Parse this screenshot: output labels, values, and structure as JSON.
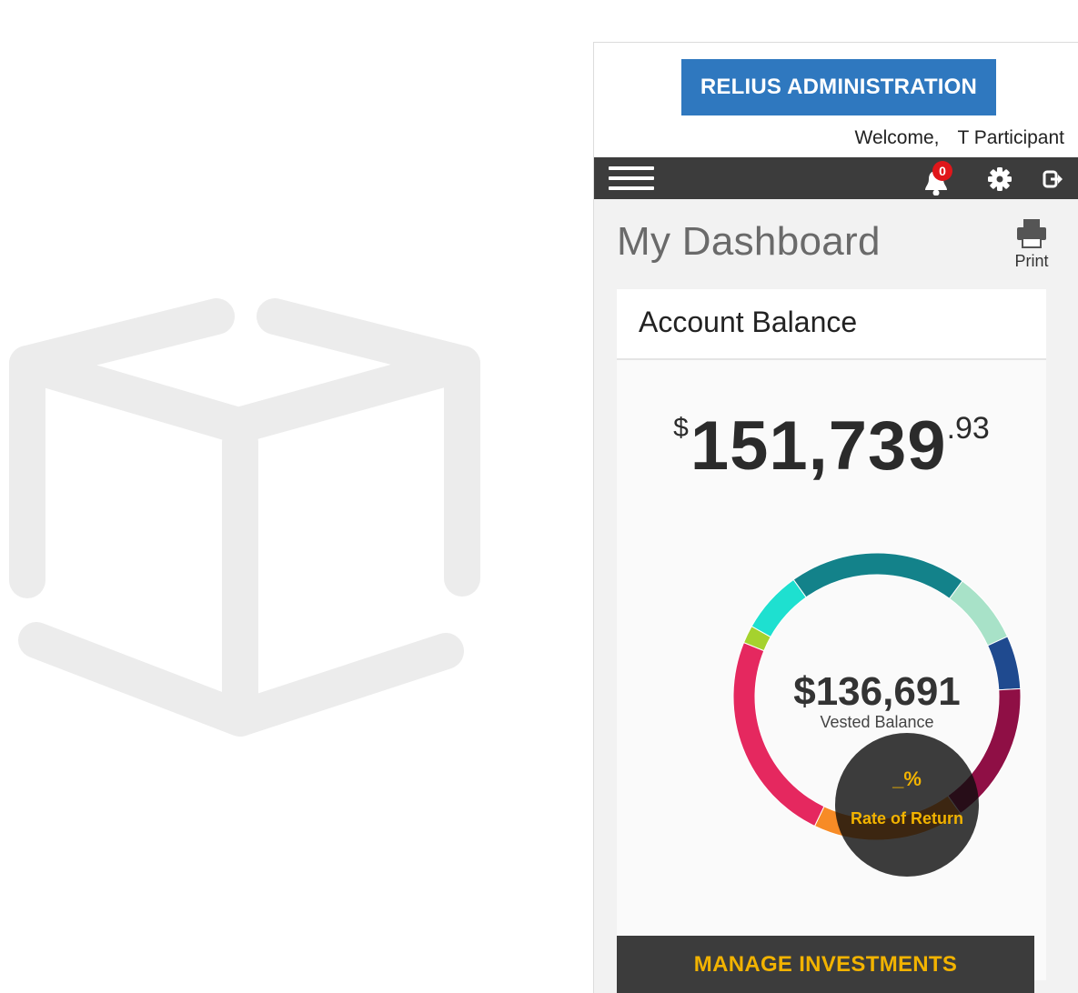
{
  "header": {
    "brand": "RELIUS ADMINISTRATION",
    "welcome_prefix": "Welcome,",
    "user_name": "T Participant"
  },
  "navbar": {
    "notification_count": "0",
    "icons": [
      "menu-icon",
      "bell-icon",
      "gear-icon",
      "logout-icon"
    ]
  },
  "page": {
    "title": "My Dashboard",
    "print_label": "Print"
  },
  "account_balance": {
    "title": "Account Balance",
    "currency_symbol": "$",
    "whole": "151,739",
    "cents": ".93"
  },
  "vested": {
    "amount": "$136,691",
    "label": "Vested Balance"
  },
  "rate_of_return": {
    "value": "_%",
    "label": "Rate of Return"
  },
  "actions": {
    "manage_investments": "MANAGE INVESTMENTS"
  },
  "colors": {
    "brand": "#2f78bf",
    "navbar": "#3c3c3c",
    "accent_gold": "#f2b300",
    "badge_red": "#e0161a"
  },
  "chart_data": {
    "type": "pie",
    "donut": true,
    "series": [
      {
        "value": 20,
        "color": "#13828a"
      },
      {
        "value": 8,
        "color": "#a8e2c8"
      },
      {
        "value": 6,
        "color": "#1f4a8f"
      },
      {
        "value": 16,
        "color": "#8f0f45"
      },
      {
        "value": 17,
        "color": "#f78b26"
      },
      {
        "value": 24,
        "color": "#e5285f"
      },
      {
        "value": 2,
        "color": "#a5d22e"
      },
      {
        "value": 7,
        "color": "#1ee0d0"
      }
    ]
  }
}
